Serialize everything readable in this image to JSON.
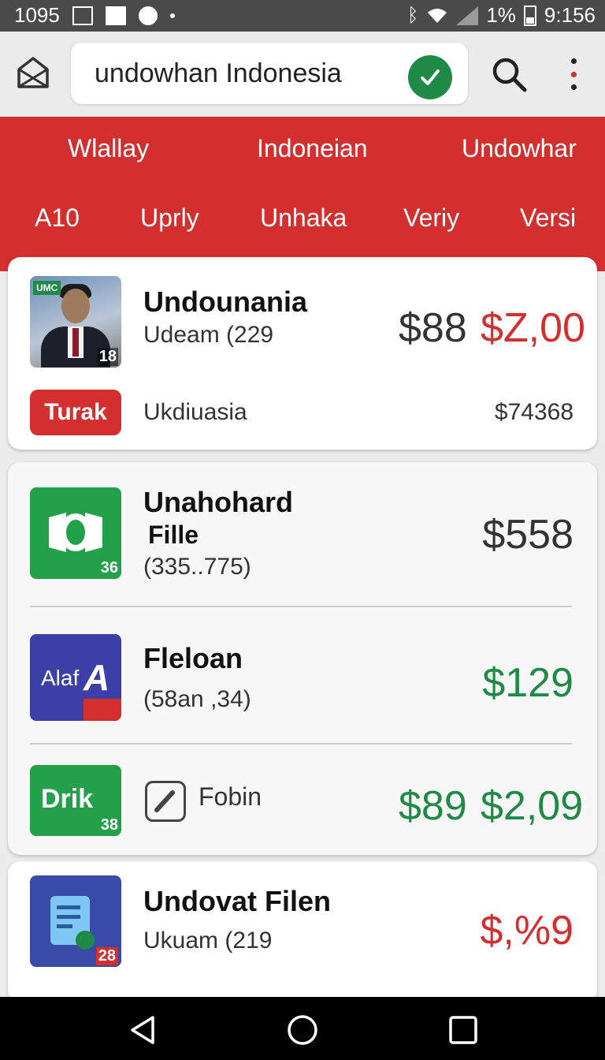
{
  "status_bar": {
    "time_left": "1095",
    "battery_percent": "1%",
    "clock": "9:156",
    "icons": [
      "square-icon",
      "activity-icon",
      "location-icon",
      "dot-icon",
      "bluetooth-icon",
      "wifi-icon",
      "signal-icon",
      "battery-icon"
    ]
  },
  "search": {
    "query": "undowhan Indonesia"
  },
  "tabs_row1": [
    "Wlallay",
    "Indoneian",
    "Undowhar"
  ],
  "tabs_row2": [
    "A10",
    "Uprly",
    "Unhaka",
    "Veriy",
    "Versi"
  ],
  "card1": {
    "badge": "UMC",
    "thumb_number": "18",
    "title": "Undounania",
    "subtitle": "Udeam (229",
    "price1": "$88",
    "price2": "$Z,00",
    "tag": "Turak",
    "row_label": "Ukdiuasia",
    "row_value": "$74368"
  },
  "card2": {
    "item1": {
      "thumb_number": "36",
      "title": "Unahohard",
      "title2": "Fille",
      "subtitle": "(335..775)",
      "price": "$558"
    },
    "item2": {
      "logo_text": "Alaf",
      "logo_letter": "A",
      "title": "Fleloan",
      "subtitle": "(58an ,34)",
      "price": "$129"
    },
    "item3": {
      "logo_text": "Drik",
      "thumb_number": "38",
      "label": "Fobin",
      "price1": "$89",
      "price2": "$2,09"
    }
  },
  "card3": {
    "thumb_number": "28",
    "title": "Undovat Filen",
    "subtitle": "Ukuam (219",
    "price": "$,%9"
  },
  "colors": {
    "accent_red": "#d32f2f",
    "accent_green": "#1e8a46"
  }
}
